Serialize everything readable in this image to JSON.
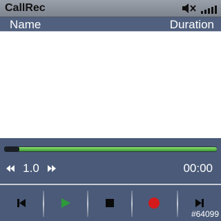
{
  "app": {
    "title": "CallRec"
  },
  "status": {
    "mute_icon": "speaker-muted-icon",
    "signal_icon": "signal-bars-icon"
  },
  "list": {
    "header_name": "Name",
    "header_duration": "Duration",
    "rows": []
  },
  "player": {
    "progress": 0.0,
    "speed_label": "1.0",
    "time_label": "00:00",
    "rewind_icon": "rewind-icon",
    "fast_forward_icon": "fast-forward-icon"
  },
  "toolbar": {
    "buttons": [
      {
        "icon": "skip-previous-icon"
      },
      {
        "icon": "play-icon",
        "color": "#2e9a3a"
      },
      {
        "icon": "stop-icon"
      },
      {
        "icon": "record-icon",
        "color": "#d41a1a"
      },
      {
        "icon": "skip-next-icon"
      }
    ]
  },
  "badge": "#64099",
  "colors": {
    "background": "#4a5a78",
    "header": "#50607e",
    "progress_fill": "#5ac04a",
    "record": "#d41a1a",
    "play": "#2e9a3a"
  }
}
